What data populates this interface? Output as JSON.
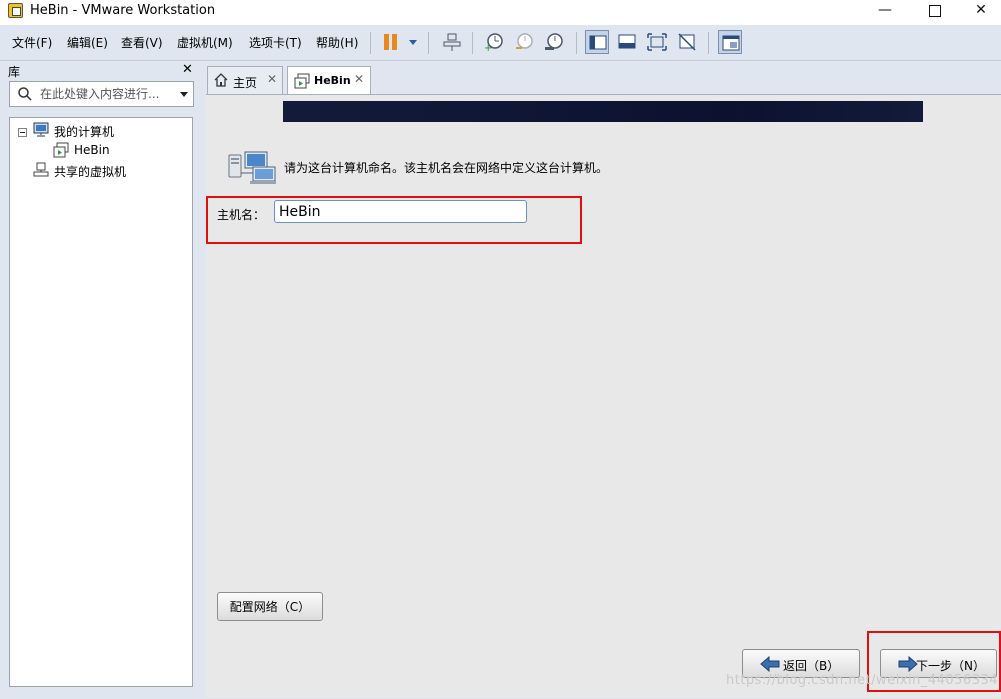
{
  "window": {
    "title": "HeBin - VMware Workstation",
    "controls": {
      "minimize": "—",
      "maximize": "",
      "close": "✕"
    }
  },
  "menubar": {
    "items": [
      "文件(F)",
      "编辑(E)",
      "查看(V)",
      "虚拟机(M)",
      "选项卡(T)",
      "帮助(H)"
    ]
  },
  "toolbar": {
    "icons": [
      "pause-icon",
      "dropdown-arrow-icon",
      "network-icon",
      "snapshot-take-icon",
      "snapshot-revert-icon",
      "snapshot-manager-icon",
      "view-sidebar-icon",
      "view-thumbnail-icon",
      "fullscreen-icon",
      "unity-icon",
      "console-view-icon"
    ]
  },
  "library": {
    "title": "库",
    "close": "✕",
    "search_placeholder": "在此处键入内容进行...",
    "tree": {
      "root": "我的计算机",
      "vm": "HeBin",
      "shared": "共享的虚拟机"
    }
  },
  "tabs": [
    {
      "label": "主页",
      "close": "✕"
    },
    {
      "label": "HeBin",
      "close": "✕"
    }
  ],
  "installer": {
    "prompt": "请为这台计算机命名。该主机名会在网络中定义这台计算机。",
    "hostname_label": "主机名：",
    "hostname_value": "HeBin",
    "configure_network_label": "配置网络（C）",
    "back_label": "返回（B）",
    "next_label": "下一步（N）",
    "highlight_color": "#e01010"
  },
  "watermark": "https://blog.csdn.net/weixin_44056334"
}
